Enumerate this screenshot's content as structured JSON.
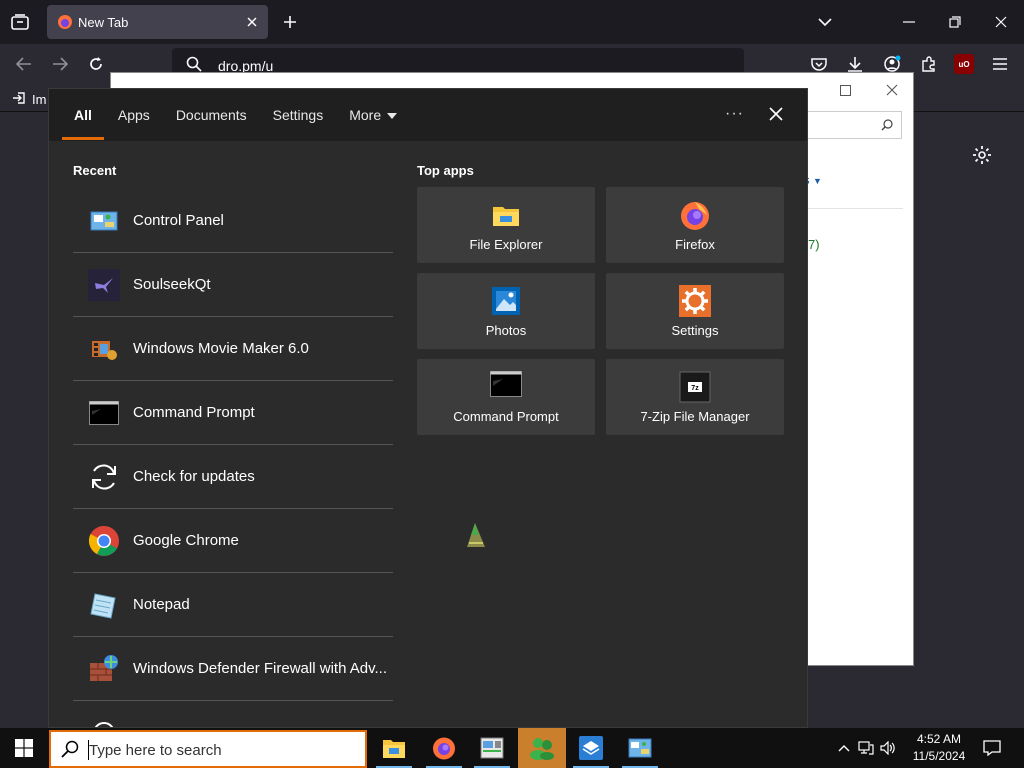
{
  "browser": {
    "tab_title": "New Tab",
    "url": "dro.pm/u",
    "bookmark_label": "Im",
    "extension_badge": "uO"
  },
  "start_menu": {
    "tabs": [
      "All",
      "Apps",
      "Documents",
      "Settings",
      "More"
    ],
    "active_tab": "All",
    "recent_title": "Recent",
    "recent": [
      {
        "label": "Control Panel",
        "icon": "control-panel-icon"
      },
      {
        "label": "SoulseekQt",
        "icon": "soulseek-icon"
      },
      {
        "label": "Windows Movie Maker 6.0",
        "icon": "movie-maker-icon"
      },
      {
        "label": "Command Prompt",
        "icon": "command-prompt-icon"
      },
      {
        "label": "Check for updates",
        "icon": "update-icon"
      },
      {
        "label": "Google Chrome",
        "icon": "chrome-icon"
      },
      {
        "label": "Notepad",
        "icon": "notepad-icon"
      },
      {
        "label": "Windows Defender Firewall with Adv...",
        "icon": "firewall-icon"
      }
    ],
    "top_apps_title": "Top apps",
    "top_apps": [
      {
        "label": "File Explorer",
        "icon": "file-explorer-icon"
      },
      {
        "label": "Firefox",
        "icon": "firefox-icon"
      },
      {
        "label": "Photos",
        "icon": "photos-icon"
      },
      {
        "label": "Settings",
        "icon": "settings-icon"
      },
      {
        "label": "Command Prompt",
        "icon": "command-prompt-icon"
      },
      {
        "label": "7-Zip File Manager",
        "icon": "7zip-icon"
      }
    ]
  },
  "control_panel_bg": {
    "link_fragment": "ns",
    "count_fragment": "7)"
  },
  "taskbar": {
    "search_placeholder": "Type here to search",
    "time": "4:52 AM",
    "date": "11/5/2024"
  },
  "colors": {
    "accent": "#e36c09",
    "start_bg": "#2b2b2b",
    "tile_bg": "#3c3c3c",
    "taskbar_bg": "#101010"
  }
}
